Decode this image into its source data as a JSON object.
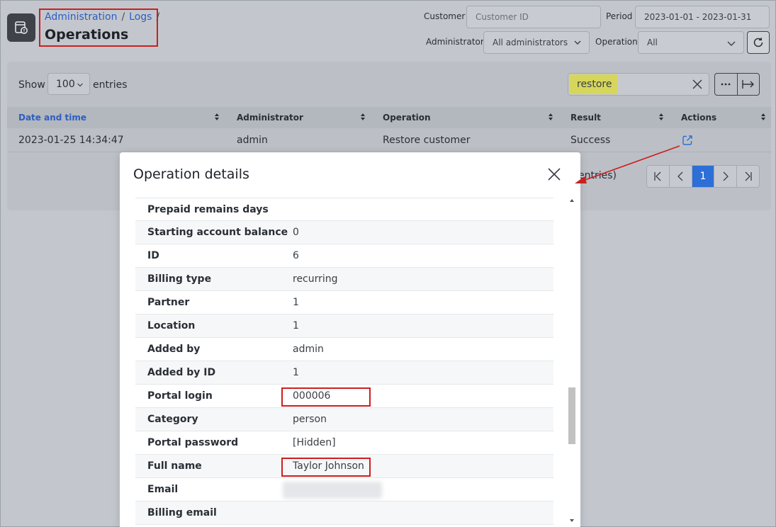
{
  "breadcrumb": {
    "item1": "Administration",
    "item2": "Logs",
    "sep": "/"
  },
  "page_title": "Operations",
  "filters": {
    "customer_label": "Customer",
    "customer_placeholder": "Customer ID",
    "period_label": "Period",
    "period_value": "2023-01-01 - 2023-01-31",
    "administrator_label": "Administrator",
    "administrator_value": "All administrators",
    "operation_label": "Operation",
    "operation_value": "All"
  },
  "table": {
    "show_label": "Show",
    "page_size": "100",
    "entries_label": "entries",
    "search_value": "restore",
    "columns": [
      "Date and time",
      "Administrator",
      "Operation",
      "Result",
      "Actions"
    ],
    "rows": [
      {
        "datetime": "2023-01-25 14:34:47",
        "administrator": "admin",
        "operation": "Restore customer",
        "result": "Success"
      }
    ],
    "pager_info": "entries)",
    "current_page": "1"
  },
  "modal": {
    "title": "Operation details",
    "rows": [
      {
        "key": "Prepaid remains days",
        "value": ""
      },
      {
        "key": "Starting account balance",
        "value": "0"
      },
      {
        "key": "ID",
        "value": "6"
      },
      {
        "key": "Billing type",
        "value": "recurring"
      },
      {
        "key": "Partner",
        "value": "1"
      },
      {
        "key": "Location",
        "value": "1"
      },
      {
        "key": "Added by",
        "value": "admin"
      },
      {
        "key": "Added by ID",
        "value": "1"
      },
      {
        "key": "Portal login",
        "value": "000006"
      },
      {
        "key": "Category",
        "value": "person"
      },
      {
        "key": "Portal password",
        "value": "[Hidden]"
      },
      {
        "key": "Full name",
        "value": "Taylor Johnson"
      },
      {
        "key": "Email",
        "value": ""
      },
      {
        "key": "Billing email",
        "value": ""
      }
    ]
  },
  "colors": {
    "accent": "#2c6fd6",
    "link": "#2c5ec2",
    "annotation": "#cc1f1f",
    "search_highlight": "#d7d65c"
  }
}
